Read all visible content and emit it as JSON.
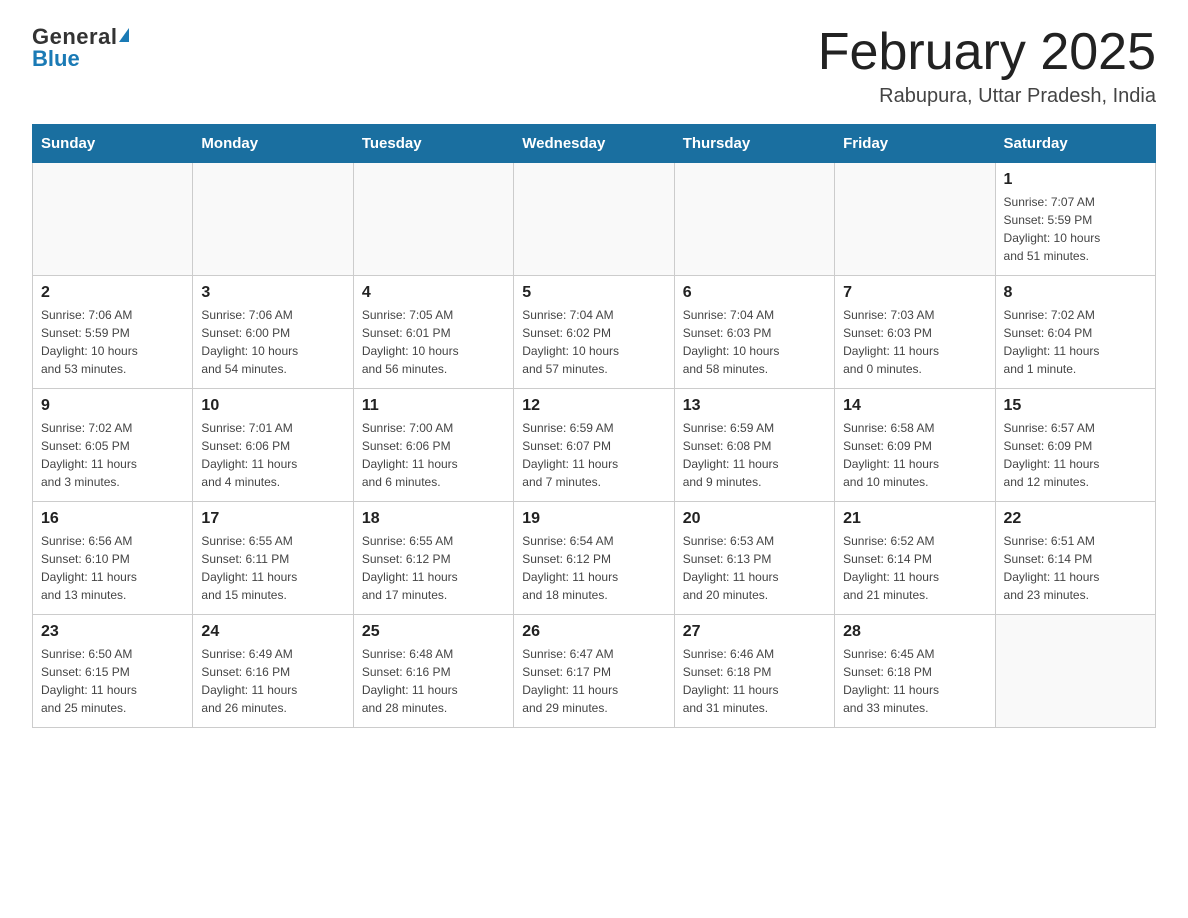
{
  "header": {
    "logo_general": "General",
    "logo_blue": "Blue",
    "month_title": "February 2025",
    "location": "Rabupura, Uttar Pradesh, India"
  },
  "days_of_week": [
    "Sunday",
    "Monday",
    "Tuesday",
    "Wednesday",
    "Thursday",
    "Friday",
    "Saturday"
  ],
  "weeks": [
    [
      {
        "day": "",
        "info": ""
      },
      {
        "day": "",
        "info": ""
      },
      {
        "day": "",
        "info": ""
      },
      {
        "day": "",
        "info": ""
      },
      {
        "day": "",
        "info": ""
      },
      {
        "day": "",
        "info": ""
      },
      {
        "day": "1",
        "info": "Sunrise: 7:07 AM\nSunset: 5:59 PM\nDaylight: 10 hours\nand 51 minutes."
      }
    ],
    [
      {
        "day": "2",
        "info": "Sunrise: 7:06 AM\nSunset: 5:59 PM\nDaylight: 10 hours\nand 53 minutes."
      },
      {
        "day": "3",
        "info": "Sunrise: 7:06 AM\nSunset: 6:00 PM\nDaylight: 10 hours\nand 54 minutes."
      },
      {
        "day": "4",
        "info": "Sunrise: 7:05 AM\nSunset: 6:01 PM\nDaylight: 10 hours\nand 56 minutes."
      },
      {
        "day": "5",
        "info": "Sunrise: 7:04 AM\nSunset: 6:02 PM\nDaylight: 10 hours\nand 57 minutes."
      },
      {
        "day": "6",
        "info": "Sunrise: 7:04 AM\nSunset: 6:03 PM\nDaylight: 10 hours\nand 58 minutes."
      },
      {
        "day": "7",
        "info": "Sunrise: 7:03 AM\nSunset: 6:03 PM\nDaylight: 11 hours\nand 0 minutes."
      },
      {
        "day": "8",
        "info": "Sunrise: 7:02 AM\nSunset: 6:04 PM\nDaylight: 11 hours\nand 1 minute."
      }
    ],
    [
      {
        "day": "9",
        "info": "Sunrise: 7:02 AM\nSunset: 6:05 PM\nDaylight: 11 hours\nand 3 minutes."
      },
      {
        "day": "10",
        "info": "Sunrise: 7:01 AM\nSunset: 6:06 PM\nDaylight: 11 hours\nand 4 minutes."
      },
      {
        "day": "11",
        "info": "Sunrise: 7:00 AM\nSunset: 6:06 PM\nDaylight: 11 hours\nand 6 minutes."
      },
      {
        "day": "12",
        "info": "Sunrise: 6:59 AM\nSunset: 6:07 PM\nDaylight: 11 hours\nand 7 minutes."
      },
      {
        "day": "13",
        "info": "Sunrise: 6:59 AM\nSunset: 6:08 PM\nDaylight: 11 hours\nand 9 minutes."
      },
      {
        "day": "14",
        "info": "Sunrise: 6:58 AM\nSunset: 6:09 PM\nDaylight: 11 hours\nand 10 minutes."
      },
      {
        "day": "15",
        "info": "Sunrise: 6:57 AM\nSunset: 6:09 PM\nDaylight: 11 hours\nand 12 minutes."
      }
    ],
    [
      {
        "day": "16",
        "info": "Sunrise: 6:56 AM\nSunset: 6:10 PM\nDaylight: 11 hours\nand 13 minutes."
      },
      {
        "day": "17",
        "info": "Sunrise: 6:55 AM\nSunset: 6:11 PM\nDaylight: 11 hours\nand 15 minutes."
      },
      {
        "day": "18",
        "info": "Sunrise: 6:55 AM\nSunset: 6:12 PM\nDaylight: 11 hours\nand 17 minutes."
      },
      {
        "day": "19",
        "info": "Sunrise: 6:54 AM\nSunset: 6:12 PM\nDaylight: 11 hours\nand 18 minutes."
      },
      {
        "day": "20",
        "info": "Sunrise: 6:53 AM\nSunset: 6:13 PM\nDaylight: 11 hours\nand 20 minutes."
      },
      {
        "day": "21",
        "info": "Sunrise: 6:52 AM\nSunset: 6:14 PM\nDaylight: 11 hours\nand 21 minutes."
      },
      {
        "day": "22",
        "info": "Sunrise: 6:51 AM\nSunset: 6:14 PM\nDaylight: 11 hours\nand 23 minutes."
      }
    ],
    [
      {
        "day": "23",
        "info": "Sunrise: 6:50 AM\nSunset: 6:15 PM\nDaylight: 11 hours\nand 25 minutes."
      },
      {
        "day": "24",
        "info": "Sunrise: 6:49 AM\nSunset: 6:16 PM\nDaylight: 11 hours\nand 26 minutes."
      },
      {
        "day": "25",
        "info": "Sunrise: 6:48 AM\nSunset: 6:16 PM\nDaylight: 11 hours\nand 28 minutes."
      },
      {
        "day": "26",
        "info": "Sunrise: 6:47 AM\nSunset: 6:17 PM\nDaylight: 11 hours\nand 29 minutes."
      },
      {
        "day": "27",
        "info": "Sunrise: 6:46 AM\nSunset: 6:18 PM\nDaylight: 11 hours\nand 31 minutes."
      },
      {
        "day": "28",
        "info": "Sunrise: 6:45 AM\nSunset: 6:18 PM\nDaylight: 11 hours\nand 33 minutes."
      },
      {
        "day": "",
        "info": ""
      }
    ]
  ]
}
